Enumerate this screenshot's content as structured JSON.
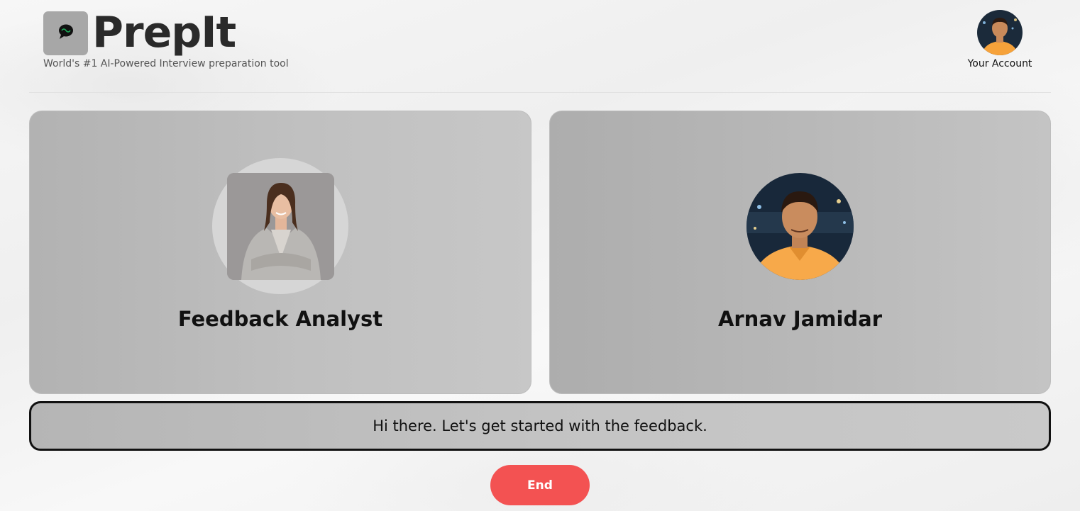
{
  "header": {
    "app_name": "PrepIt",
    "tagline": "World's #1 AI-Powered Interview preparation tool",
    "logo_icon": "chat-bubble-icon",
    "account_label": "Your Account",
    "account_avatar": "user-avatar"
  },
  "participants": [
    {
      "name": "Feedback Analyst",
      "avatar": "analyst-avatar"
    },
    {
      "name": "Arnav Jamidar",
      "avatar": "user-avatar"
    }
  ],
  "message": "Hi there. Let's get started with the feedback.",
  "controls": {
    "end_label": "End"
  },
  "colors": {
    "end_button": "#f35252",
    "logo_tile": "#a7a7a7",
    "card_background": "#b8b8b8"
  }
}
